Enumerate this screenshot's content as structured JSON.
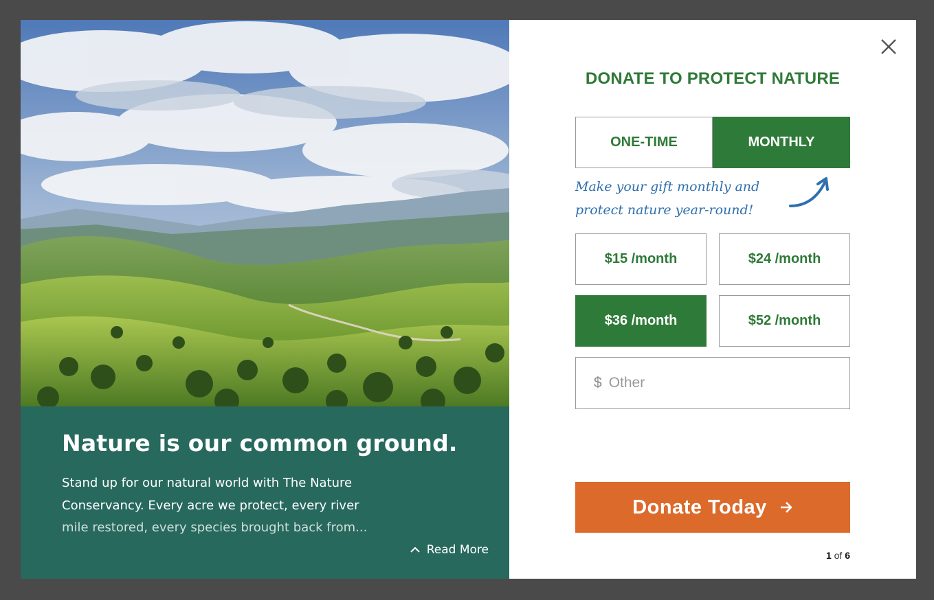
{
  "story": {
    "headline": "Nature is our common ground.",
    "body_visible": "Stand up for our natural world with The Nature Conservancy. Every acre we protect, every river ",
    "body_fade": "mile restored, every species brought back from...",
    "read_more_label": "Read More"
  },
  "donation": {
    "title": "DONATE TO PROTECT NATURE",
    "frequency": {
      "one_time_label": "ONE-TIME",
      "monthly_label": "MONTHLY",
      "selected": "MONTHLY"
    },
    "nudge": {
      "line1": "Make your gift monthly and",
      "line2": "protect nature year-round!"
    },
    "amounts": [
      {
        "label": "$15 /month",
        "selected": false
      },
      {
        "label": "$24 /month",
        "selected": false
      },
      {
        "label": "$36 /month",
        "selected": true
      },
      {
        "label": "$52 /month",
        "selected": false
      }
    ],
    "other": {
      "currency": "$",
      "placeholder": "Other",
      "value": ""
    },
    "cta_label": "Donate Today",
    "pager": {
      "current": "1",
      "separator": "of",
      "total": "6"
    }
  },
  "icons": {
    "close": "close-icon",
    "chevron": "chevron-up-icon",
    "cta_arrow": "arrow-right-icon",
    "nudge_arrow": "curved-arrow-icon"
  },
  "colors": {
    "brand_green": "#2e7a38",
    "story_bg": "#27695d",
    "cta_orange": "#dc6a2b",
    "nudge_blue": "#2f6fae"
  }
}
